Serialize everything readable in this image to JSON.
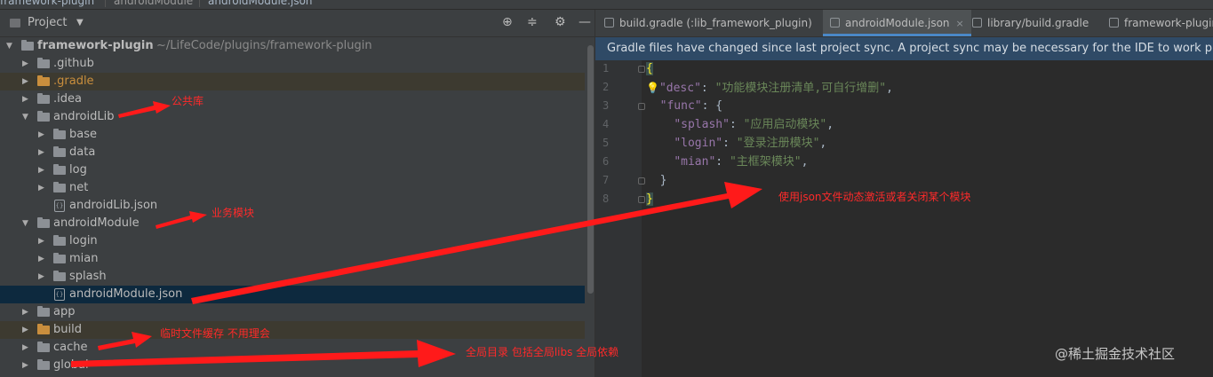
{
  "breadcrumb": {
    "root": "framework-plugin",
    "module": "androidModule",
    "file": "androidModule.json"
  },
  "project_panel": {
    "title": "Project",
    "icons": [
      "locate-icon",
      "collapse-icon",
      "gear-icon",
      "minimize-icon"
    ]
  },
  "tree": {
    "root_label": "framework-plugin",
    "root_path": "~/LifeCode/plugins/framework-plugin",
    "items": [
      {
        "label": ".github"
      },
      {
        "label": ".gradle"
      },
      {
        "label": ".idea"
      },
      {
        "label": "androidLib"
      },
      {
        "label": "base"
      },
      {
        "label": "data"
      },
      {
        "label": "log"
      },
      {
        "label": "net"
      },
      {
        "label": "androidLib.json"
      },
      {
        "label": "androidModule"
      },
      {
        "label": "login"
      },
      {
        "label": "mian"
      },
      {
        "label": "splash"
      },
      {
        "label": "androidModule.json"
      },
      {
        "label": "app"
      },
      {
        "label": "build"
      },
      {
        "label": "cache"
      },
      {
        "label": "global"
      }
    ]
  },
  "tabs": [
    {
      "label": "build.gradle (:lib_framework_plugin)"
    },
    {
      "label": "androidModule.json",
      "close": "×"
    },
    {
      "label": "library/build.gradle"
    },
    {
      "label": "framework-plugin"
    }
  ],
  "banner": "Gradle files have changed since last project sync. A project sync may be necessary for the IDE to work p",
  "editor": {
    "line_numbers": [
      "1",
      "2",
      "3",
      "4",
      "5",
      "6",
      "7",
      "8"
    ],
    "lines": {
      "l1": "{",
      "l2_key": "\"desc\"",
      "l2_val": "\"功能模块注册清单,可自行增删\"",
      "l3_key": "\"func\"",
      "l4_key": "\"splash\"",
      "l4_val": "\"应用启动模块\"",
      "l5_key": "\"login\"",
      "l5_val": "\"登录注册模块\"",
      "l6_key": "\"mian\"",
      "l6_val": "\"主框架模块\"",
      "l7": "}",
      "l8": "}"
    }
  },
  "annotations": {
    "public_lib": "公共库",
    "business_module": "业务模块",
    "json_toggle": "使用json文件动态激活或者关闭某个模块",
    "cache": "临时文件缓存 不用理会",
    "global": "全局目录 包括全局libs 全局依赖"
  },
  "watermark": "@稀土掘金技术社区",
  "colors": {
    "arrow": "#ff1a1a",
    "selection": "#0d293e",
    "banner": "#2f4a66",
    "accent": "#4a88c7"
  }
}
